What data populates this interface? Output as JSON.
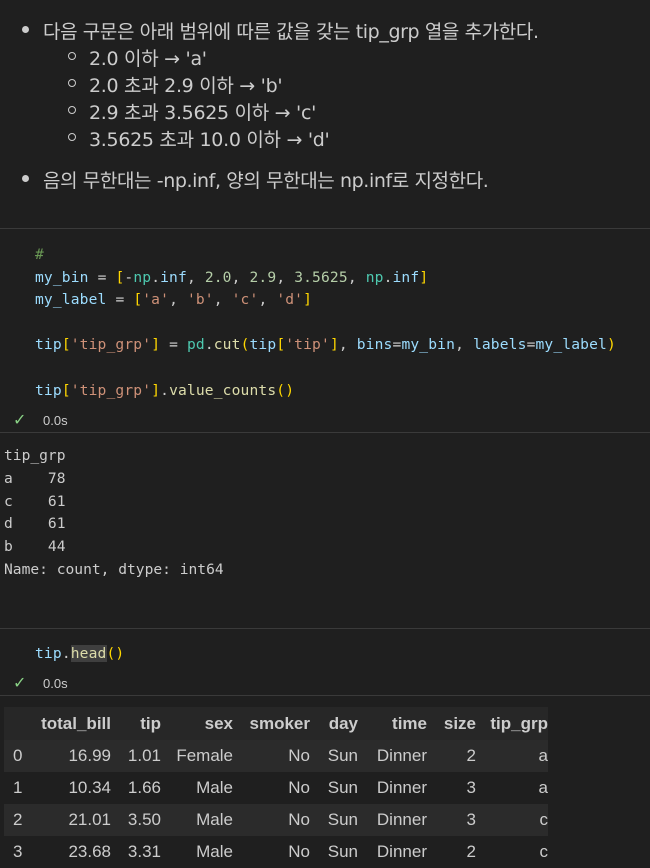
{
  "markdown": {
    "bullets": [
      "다음 구문은 아래 범위에 따른 값을 갖는 tip_grp 열을 추가한다.",
      "음의 무한대는 -np.inf, 양의 무한대는 np.inf로 지정한다."
    ],
    "sub_bullets": [
      "2.0 이하 → 'a'",
      "2.0 초과 2.9 이하 → 'b'",
      "2.9 초과 3.5625 이하 → 'c'",
      "3.5625 초과 10.0 이하 → 'd'"
    ]
  },
  "cell1": {
    "status_time": "0.0s",
    "output": [
      "tip_grp",
      "a    78",
      "c    61",
      "d    61",
      "b    44",
      "Name: count, dtype: int64"
    ]
  },
  "cell2": {
    "status_time": "0.0s"
  },
  "table": {
    "columns": [
      "",
      "total_bill",
      "tip",
      "sex",
      "smoker",
      "day",
      "time",
      "size",
      "tip_grp"
    ],
    "rows": [
      [
        "0",
        "16.99",
        "1.01",
        "Female",
        "No",
        "Sun",
        "Dinner",
        "2",
        "a"
      ],
      [
        "1",
        "10.34",
        "1.66",
        "Male",
        "No",
        "Sun",
        "Dinner",
        "3",
        "a"
      ],
      [
        "2",
        "21.01",
        "3.50",
        "Male",
        "No",
        "Sun",
        "Dinner",
        "3",
        "c"
      ],
      [
        "3",
        "23.68",
        "3.31",
        "Male",
        "No",
        "Sun",
        "Dinner",
        "2",
        "c"
      ]
    ]
  }
}
